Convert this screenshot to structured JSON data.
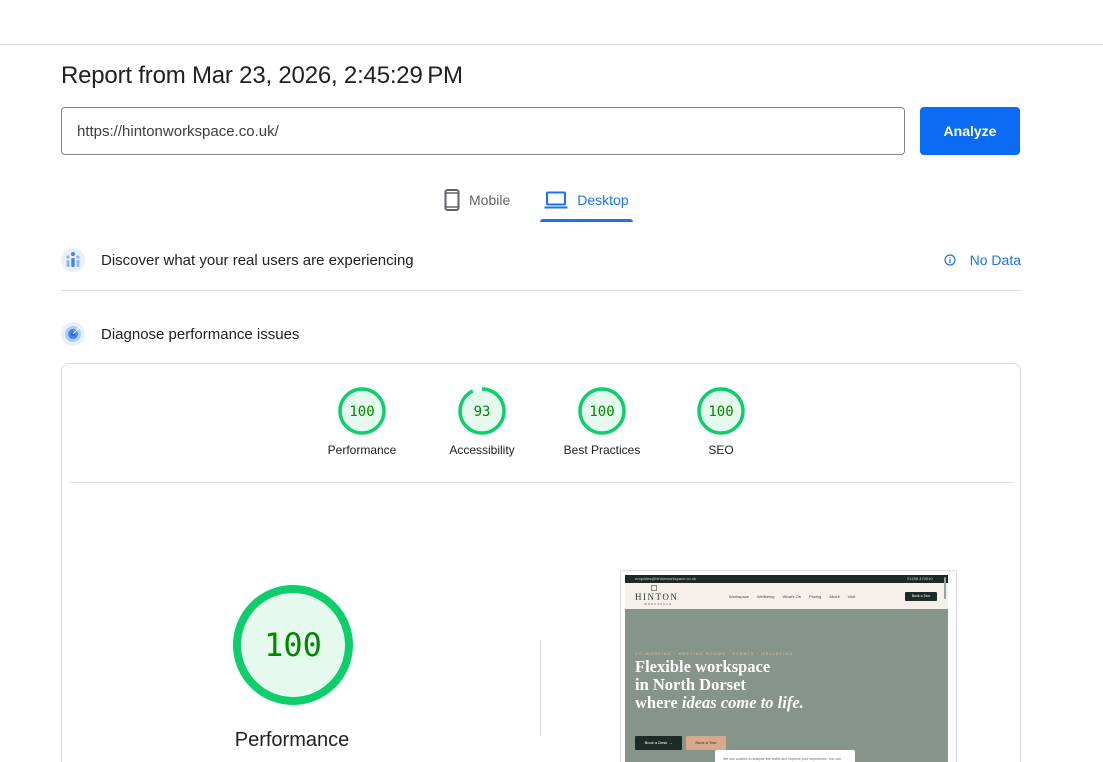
{
  "report": {
    "title": "Report from Mar 23, 2026, 2:45:29 PM",
    "url_value": "https://hintonworkspace.co.uk/",
    "analyze_label": "Analyze"
  },
  "device_tabs": [
    {
      "label": "Mobile",
      "icon": "smartphone-icon",
      "selected": false
    },
    {
      "label": "Desktop",
      "icon": "laptop-icon",
      "selected": true
    }
  ],
  "crux": {
    "title": "Discover what your real users are experiencing",
    "status": "No Data",
    "icon": "real-users-icon"
  },
  "diagnose": {
    "title": "Diagnose performance issues",
    "icon": "lighthouse-icon"
  },
  "categories": [
    {
      "label": "Performance",
      "score": "100"
    },
    {
      "label": "Accessibility",
      "score": "93"
    },
    {
      "label": "Best Practices",
      "score": "100"
    },
    {
      "label": "SEO",
      "score": "100"
    }
  ],
  "main_score": {
    "score": "100",
    "label": "Performance"
  },
  "colors": {
    "pass": "#0cce6b",
    "pass_fill": "#e6f9ee",
    "pass_text": "#008800",
    "accent": "#1a73e8"
  },
  "screenshot": {
    "topbar_email": "enquiries@hintonworkspace.co.uk",
    "topbar_phone": "01258 470010",
    "logo": "HINTON",
    "logo_sub": "WORKSPACE",
    "nav_links": [
      "Workspace",
      "Wellbeing",
      "What's On",
      "Pricing",
      "About",
      "Visit"
    ],
    "nav_button": "Book a Tour",
    "eyebrow": "CO-WORKING · MEETING ROOMS · EVENTS · WELLBEING",
    "headline_lines": [
      "Flexible workspace",
      "in North Dorset",
      "where "
    ],
    "headline_italic": "ideas come to life.",
    "btn_primary": "Book a Desk →",
    "btn_secondary": "Book a Tour",
    "cookie_text": "We use cookies to analyse site traffic and improve your experience. You can"
  }
}
